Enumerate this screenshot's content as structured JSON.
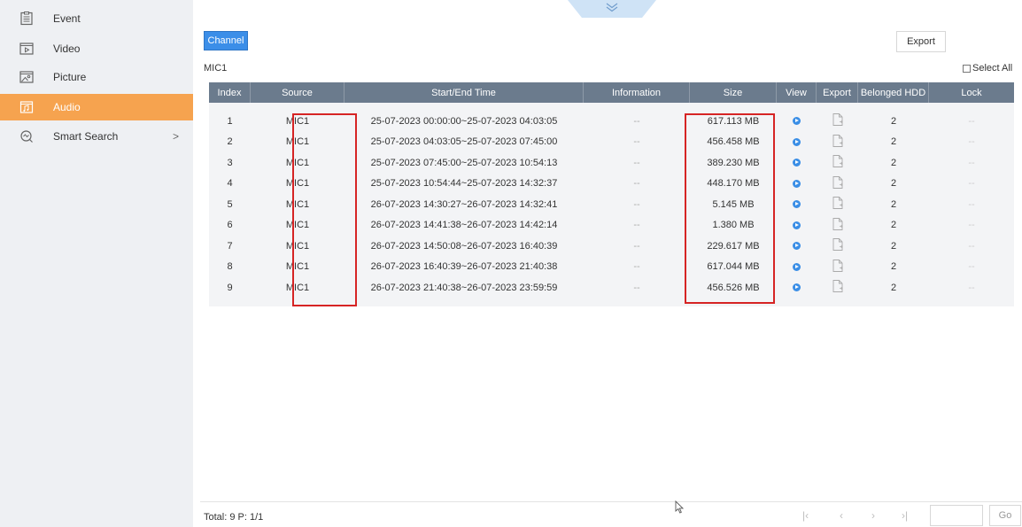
{
  "sidebar": {
    "items": [
      {
        "label": "Event",
        "icon": "event-icon"
      },
      {
        "label": "Video",
        "icon": "video-icon"
      },
      {
        "label": "Picture",
        "icon": "picture-icon"
      },
      {
        "label": "Audio",
        "icon": "audio-icon",
        "active": true
      },
      {
        "label": "Smart Search",
        "icon": "smart-search-icon",
        "chevron": ">"
      }
    ]
  },
  "toolbar": {
    "channel_label": "Channel",
    "export_label": "Export",
    "pulldown_icon": "double-chevron-down-icon"
  },
  "channel_name": "MIC1",
  "select_all_label": "Select All",
  "table": {
    "columns": [
      "Index",
      "Source",
      "Start/End Time",
      "Information",
      "Size",
      "View",
      "Export",
      "Belonged HDD",
      "Lock"
    ],
    "rows": [
      {
        "index": "1",
        "source": "MIC1",
        "time": "25-07-2023 00:00:00~25-07-2023 04:03:05",
        "info": "--",
        "size": "617.113 MB",
        "hdd": "2",
        "lock": "--"
      },
      {
        "index": "2",
        "source": "MIC1",
        "time": "25-07-2023 04:03:05~25-07-2023 07:45:00",
        "info": "--",
        "size": "456.458 MB",
        "hdd": "2",
        "lock": "--"
      },
      {
        "index": "3",
        "source": "MIC1",
        "time": "25-07-2023 07:45:00~25-07-2023 10:54:13",
        "info": "--",
        "size": "389.230 MB",
        "hdd": "2",
        "lock": "--"
      },
      {
        "index": "4",
        "source": "MIC1",
        "time": "25-07-2023 10:54:44~25-07-2023 14:32:37",
        "info": "--",
        "size": "448.170 MB",
        "hdd": "2",
        "lock": "--"
      },
      {
        "index": "5",
        "source": "MIC1",
        "time": "26-07-2023 14:30:27~26-07-2023 14:32:41",
        "info": "--",
        "size": "5.145 MB",
        "hdd": "2",
        "lock": "--"
      },
      {
        "index": "6",
        "source": "MIC1",
        "time": "26-07-2023 14:41:38~26-07-2023 14:42:14",
        "info": "--",
        "size": "1.380 MB",
        "hdd": "2",
        "lock": "--"
      },
      {
        "index": "7",
        "source": "MIC1",
        "time": "26-07-2023 14:50:08~26-07-2023 16:40:39",
        "info": "--",
        "size": "229.617 MB",
        "hdd": "2",
        "lock": "--"
      },
      {
        "index": "8",
        "source": "MIC1",
        "time": "26-07-2023 16:40:39~26-07-2023 21:40:38",
        "info": "--",
        "size": "617.044 MB",
        "hdd": "2",
        "lock": "--"
      },
      {
        "index": "9",
        "source": "MIC1",
        "time": "26-07-2023 21:40:38~26-07-2023 23:59:59",
        "info": "--",
        "size": "456.526 MB",
        "hdd": "2",
        "lock": "--"
      }
    ]
  },
  "footer": {
    "total_text": "Total: 9  P: 1/1",
    "go_label": "Go",
    "pager_icons": [
      "first-page-icon",
      "prev-page-icon",
      "next-page-icon",
      "last-page-icon"
    ]
  },
  "colors": {
    "accent": "#3b8ee8",
    "active_sidebar": "#f6a34f",
    "table_header": "#6b7b8d",
    "highlight_box": "#d62424"
  }
}
